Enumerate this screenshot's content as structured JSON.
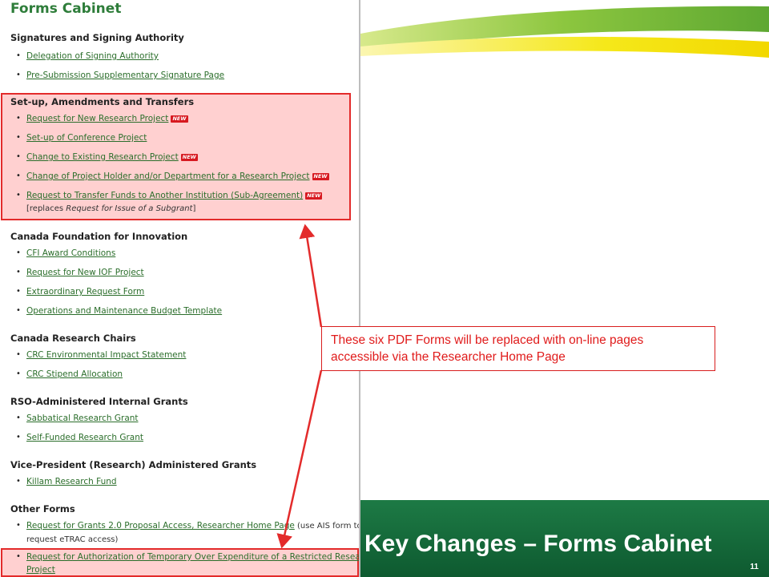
{
  "page_title": "Forms Cabinet",
  "new_badge": "NEW",
  "sections": [
    {
      "title": "Signatures and Signing Authority",
      "items": [
        "Delegation of Signing Authority",
        "Pre-Submission Supplementary Signature Page"
      ]
    },
    {
      "title": "Set-up, Amendments and Transfers",
      "items": [
        "Request for New Research Project",
        "Set-up of Conference Project",
        "Change to Existing Research Project",
        "Change of Project Holder and/or Department for a Research Project",
        "Request to Transfer Funds to Another Institution (Sub-Agreement)"
      ],
      "note_prefix": "[replaces ",
      "note_italic": "Request for Issue of a Subgrant",
      "note_suffix": "]"
    },
    {
      "title": "Canada Foundation for Innovation",
      "items": [
        "CFI Award Conditions",
        "Request for New IOF Project",
        "Extraordinary Request Form",
        "Operations and Maintenance Budget Template"
      ]
    },
    {
      "title": "Canada Research Chairs",
      "items": [
        "CRC Environmental Impact Statement",
        "CRC Stipend Allocation"
      ]
    },
    {
      "title": "RSO-Administered Internal Grants",
      "items": [
        "Sabbatical Research Grant",
        "Self-Funded Research Grant"
      ]
    },
    {
      "title": "Vice-President (Research) Administered Grants",
      "items": [
        "Killam Research Fund"
      ]
    },
    {
      "title": "Other Forms",
      "items": [
        "Request for Grants 2.0 Proposal Access, Researcher Home Page",
        "Request for Authorization of Temporary Over Expenditure of a Restricted Research",
        "Project"
      ],
      "item0_suffix": " (use AIS form to",
      "item0_line2": "request eTRAC access)"
    }
  ],
  "callout": {
    "line1": "These six PDF Forms will be replaced with on-line pages",
    "line2": "accessible via the Researcher Home Page"
  },
  "slide": {
    "title": "Key Changes – Forms Cabinet",
    "page_number": "11"
  },
  "colors": {
    "link": "#2b6e2b",
    "highlight_border": "#e32b2b",
    "callout_text": "#e01b1b",
    "banner": "#1d7a45",
    "swoosh_green": "#8cc63f",
    "swoosh_yellow": "#f2e200"
  }
}
